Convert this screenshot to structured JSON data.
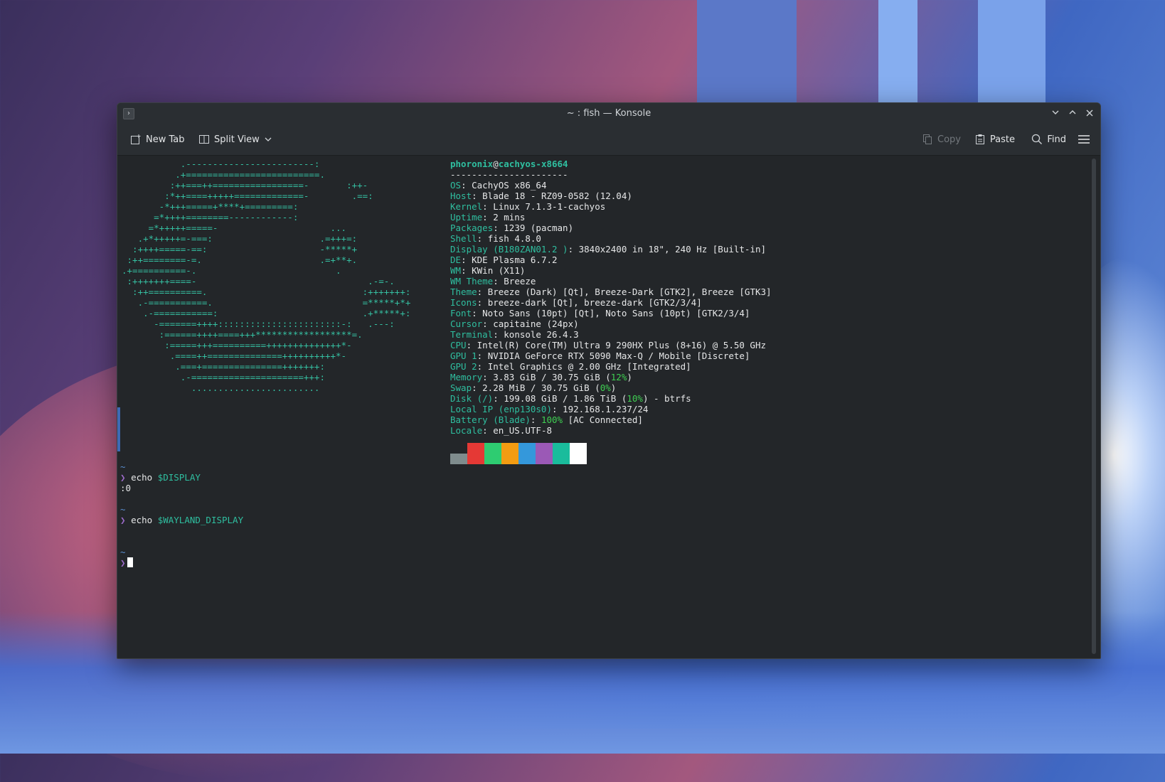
{
  "window": {
    "title": "~ : fish — Konsole"
  },
  "toolbar": {
    "new_tab": "New Tab",
    "split_view": "Split View",
    "copy": "Copy",
    "paste": "Paste",
    "find": "Find"
  },
  "neofetch": {
    "ascii_lines": [
      "           .------------------------:",
      "          .+=========================.",
      "         :++===++=================-       :++-",
      "        :*++====+++++=============-        .==:",
      "       -*+++=====+****+=========:",
      "      =*++++========------------:",
      "     =*+++++=====-                     ...",
      "   .+*+++++=-===:                    .=+++=:",
      "  :++++=====-==:                     -*****+",
      " :++========-=.                      .=+**+.",
      ".+==========-.                          .",
      " :+++++++====-                                .-=-.",
      "  :++==========.                             :+++++++:",
      "   .-===========.                            =*****+*+",
      "    .-===========:                           .+*****+:",
      "      -=======++++:::::::::::::::::::::::-:   .---:",
      "       :======++++====+++******************=.",
      "        :=====+++==========++++++++++++++*-",
      "         .====++==============++++++++++*-",
      "          .===+===============+++++++:",
      "           .-=====================+++:",
      "             ........................"
    ],
    "user": "phoronix",
    "at": "@",
    "host": "cachyos-x8664",
    "separator": "----------------------",
    "rows": [
      {
        "key": "OS",
        "val": ": CachyOS x86_64"
      },
      {
        "key": "Host",
        "val": ": Blade 18 - RZ09-0582 (12.04)"
      },
      {
        "key": "Kernel",
        "val": ": Linux 7.1.3-1-cachyos"
      },
      {
        "key": "Uptime",
        "val": ": 2 mins"
      },
      {
        "key": "Packages",
        "val": ": 1239 (pacman)"
      },
      {
        "key": "Shell",
        "val": ": fish 4.8.0"
      },
      {
        "key": "Display (B180ZAN01.2 )",
        "val": ": 3840x2400 in 18\", 240 Hz [Built-in]"
      },
      {
        "key": "DE",
        "val": ": KDE Plasma 6.7.2"
      },
      {
        "key": "WM",
        "val": ": KWin (X11)"
      },
      {
        "key": "WM Theme",
        "val": ": Breeze"
      },
      {
        "key": "Theme",
        "val": ": Breeze (Dark) [Qt], Breeze-Dark [GTK2], Breeze [GTK3]"
      },
      {
        "key": "Icons",
        "val": ": breeze-dark [Qt], breeze-dark [GTK2/3/4]"
      },
      {
        "key": "Font",
        "val": ": Noto Sans (10pt) [Qt], Noto Sans (10pt) [GTK2/3/4]"
      },
      {
        "key": "Cursor",
        "val": ": capitaine (24px)"
      },
      {
        "key": "Terminal",
        "val": ": konsole 26.4.3"
      },
      {
        "key": "CPU",
        "val": ": Intel(R) Core(TM) Ultra 9 290HX Plus (8+16) @ 5.50 GHz"
      },
      {
        "key": "GPU 1",
        "val": ": NVIDIA GeForce RTX 5090 Max-Q / Mobile [Discrete]"
      },
      {
        "key": "GPU 2",
        "val": ": Intel Graphics @ 2.00 GHz [Integrated]"
      },
      {
        "key": "Memory",
        "val": ": 3.83 GiB / 30.75 GiB (",
        "pct": "12%",
        "tail": ")"
      },
      {
        "key": "Swap",
        "val": ": 2.28 MiB / 30.75 GiB (",
        "pct": "0%",
        "tail": ")"
      },
      {
        "key": "Disk (/)",
        "val": ": 199.08 GiB / 1.86 TiB (",
        "pct": "10%",
        "tail": ") - btrfs"
      },
      {
        "key": "Local IP (enp130s0)",
        "val": ": 192.168.1.237/24"
      },
      {
        "key": "Battery (Blade)",
        "val": ": ",
        "pct": "100%",
        "tail": " [AC Connected]"
      },
      {
        "key": "Locale",
        "val": ": en_US.UTF-8"
      }
    ],
    "swatches": [
      "#7f8c8d",
      "#e53935",
      "#2ecc71",
      "#f39c12",
      "#3498db",
      "#9b59b6",
      "#1abc9c",
      "#ffffff"
    ]
  },
  "shell": {
    "tilde": "~",
    "prompt": "❯",
    "cmd_word": "echo",
    "cmd1_var": "$DISPLAY",
    "out1": ":0",
    "cmd2_var": "$WAYLAND_DISPLAY"
  }
}
